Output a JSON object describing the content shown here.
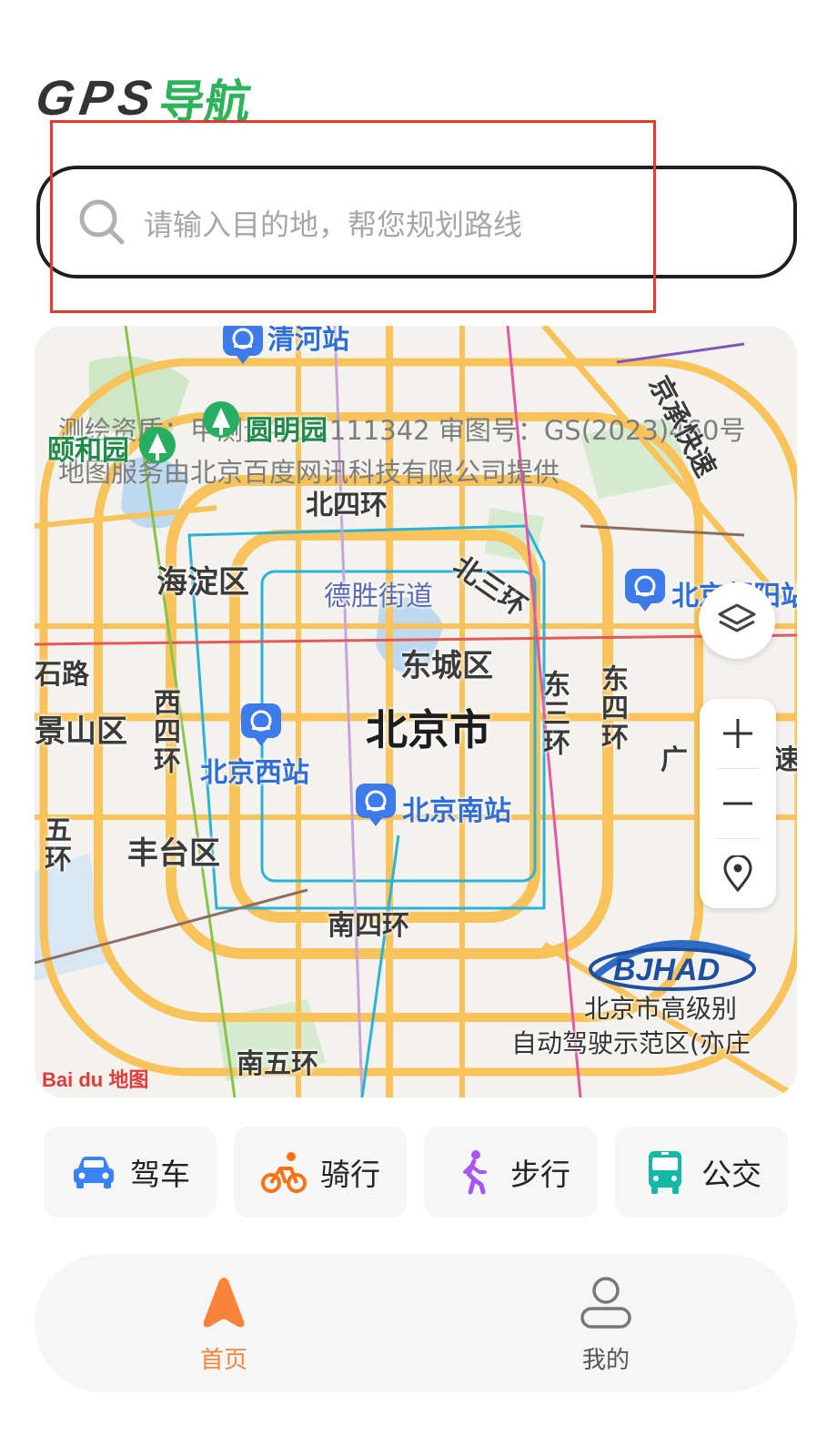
{
  "app": {
    "logo_latin": "GPS",
    "logo_cn": "导航"
  },
  "search": {
    "placeholder": "请输入目的地，帮您规划路线"
  },
  "map": {
    "attribution": {
      "line1": "测绘资质：甲测资字11111342    审图号：GS(2023)460号",
      "line2": "地图服务由北京百度网讯科技有限公司提供"
    },
    "labels": {
      "city": "北京市",
      "haidian": "海淀区",
      "dongcheng": "东城区",
      "fengtai": "丰台区",
      "shijingshan": "景山区",
      "shilu": "石路",
      "desheng": "德胜街道",
      "bei_si_huan": "北四环",
      "bei_san_huan": "北三环",
      "nan_si_huan": "南四环",
      "nan_wu_huan": "南五环",
      "xi_si_huan": "西四环",
      "dong_san_huan": "东三环",
      "dong_si_huan": "东四环",
      "jing_cheng": "京承快速",
      "guang": "广",
      "su": "速",
      "wu_huan": "五环",
      "qinghe_station": "清河站",
      "beijing_west": "北京西站",
      "beijing_south": "北京南站",
      "beijing_chaoyang": "北京朝阳站",
      "yiheyuan": "颐和园",
      "yuanmingyuan": "圆明园",
      "bjhad_line1": "北京市高级别",
      "bjhad_line2": "自动驾驶示范区(亦庄",
      "bjhad_logo": "BJHAD",
      "baidu_logo": "Bai du 地图"
    }
  },
  "modes": [
    {
      "label": "驾车",
      "icon": "car-icon",
      "color": "#3b82f6"
    },
    {
      "label": "骑行",
      "icon": "bike-icon",
      "color": "#f97316"
    },
    {
      "label": "步行",
      "icon": "walk-icon",
      "color": "#a855f7"
    },
    {
      "label": "公交",
      "icon": "bus-icon",
      "color": "#14b8a6"
    }
  ],
  "tabs": [
    {
      "label": "首页",
      "icon": "navigation-arrow-icon",
      "active": true,
      "color": "#f7843a"
    },
    {
      "label": "我的",
      "icon": "user-icon",
      "active": false,
      "color": "#555555"
    }
  ]
}
